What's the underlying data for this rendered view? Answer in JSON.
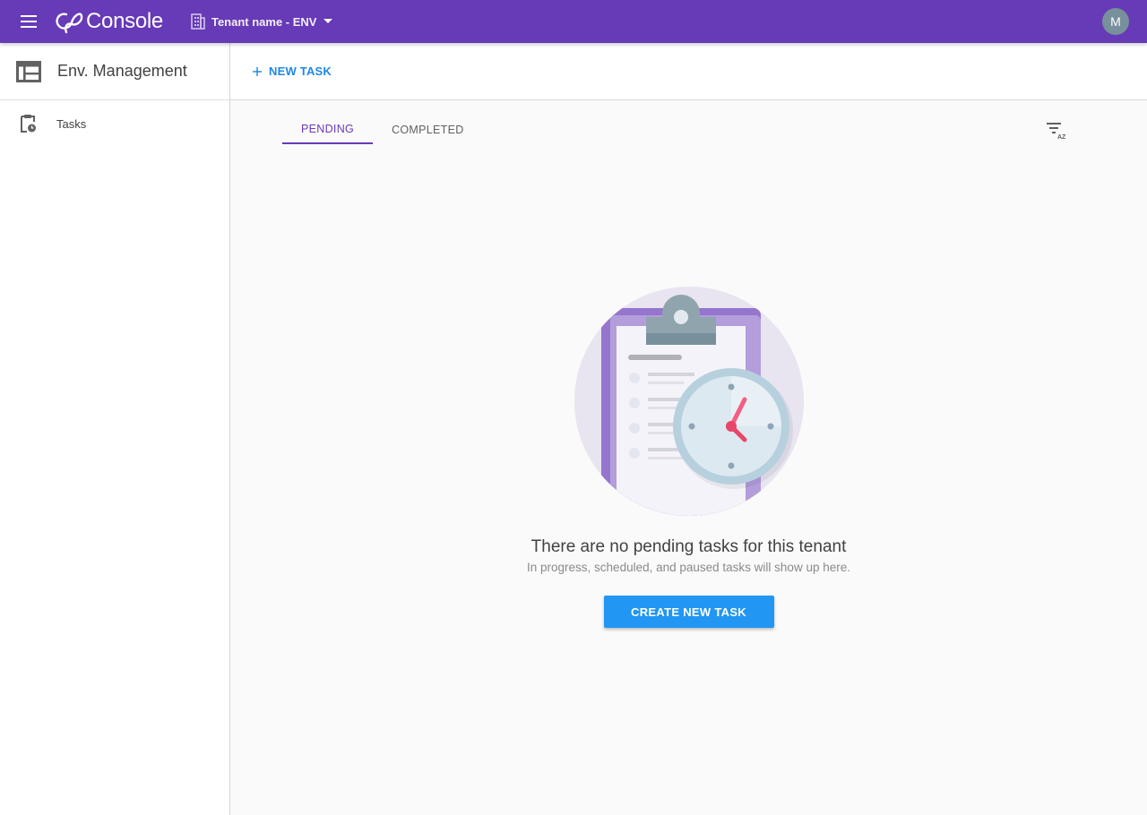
{
  "topbar": {
    "menu_icon": "hamburger-menu-icon",
    "app_name": "Console",
    "tenant_label": "Tenant name - ENV",
    "tenant_icon": "building-icon",
    "avatar_initial": "M",
    "bar_color": "#673ab7"
  },
  "sidebar": {
    "title": "Env. Management",
    "items": [
      {
        "label": "Tasks",
        "icon": "clipboard-clock-icon"
      }
    ]
  },
  "main": {
    "new_task_label": "NEW TASK",
    "tabs": [
      {
        "label": "PENDING",
        "active": true
      },
      {
        "label": "COMPLETED",
        "active": false
      }
    ],
    "sort_icon": "sort-az-icon",
    "empty_state": {
      "title": "There are no pending tasks for this tenant",
      "subtitle": "In progress, scheduled, and paused tasks will show up here.",
      "cta_label": "CREATE NEW TASK"
    }
  },
  "colors": {
    "accent": "#673ab7",
    "primary_button": "#2196f3",
    "link": "#1e88e5"
  }
}
